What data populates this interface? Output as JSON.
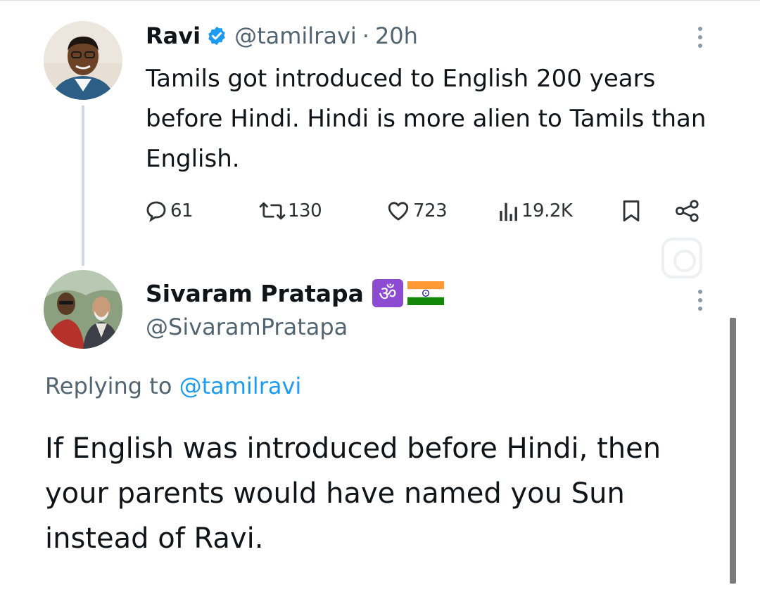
{
  "tweet1": {
    "name": "Ravi",
    "handle": "@tamilravi",
    "dot": "·",
    "time": "20h",
    "text": "Tamils got introduced to English 200 years before Hindi. Hindi is more alien to Tamils than English.",
    "icons": {
      "verified": "verified-badge-icon",
      "more": "more-options-icon"
    },
    "actions": {
      "replies": "61",
      "reposts": "130",
      "likes": "723",
      "views": "19.2K"
    }
  },
  "tweet2": {
    "name": "Sivaram Pratapa",
    "badge_symbol": "ॐ",
    "handle": "@SivaramPratapa",
    "replying_prefix": "Replying to ",
    "replying_handle": "@tamilravi",
    "text": "If English was introduced before Hindi, then your parents would have named you Sun instead of Ravi."
  },
  "colors": {
    "text_primary": "#0f1419",
    "text_secondary": "#536471",
    "link_blue": "#1d9bf0",
    "verified_blue": "#1d9bf0",
    "om_purple": "#8d4bd1",
    "thread_line": "#cfd9de"
  }
}
